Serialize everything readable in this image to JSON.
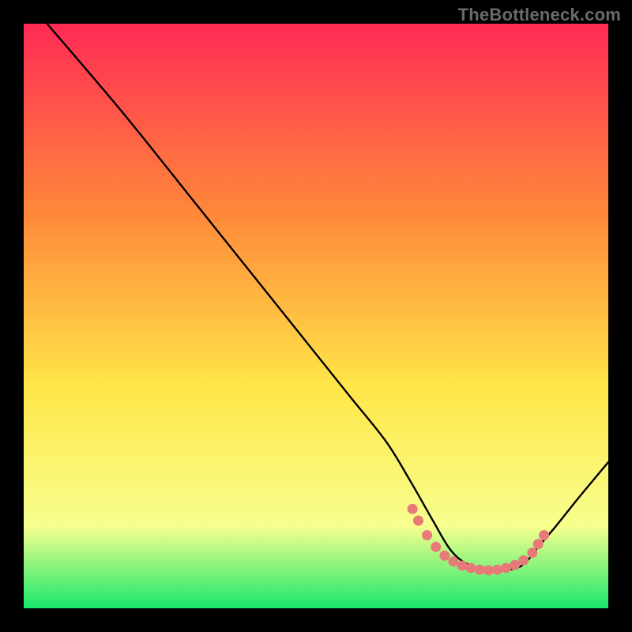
{
  "watermark": "TheBottleneck.com",
  "chart_data": {
    "type": "line",
    "title": "",
    "xlabel": "",
    "ylabel": "",
    "xlim": [
      0,
      100
    ],
    "ylim": [
      0,
      100
    ],
    "grid": false,
    "background_gradient": {
      "top": "#ff2a55",
      "mid1": "#ff8a3a",
      "mid2": "#ffe648",
      "band": "#f7ff8e",
      "bottom": "#17e86b"
    },
    "curve": {
      "name": "bottleneck-curve",
      "description": "Black curve starting at top-left, descending to a flat minimum near x≈73–85, then rising toward the right edge.",
      "x": [
        4,
        10,
        18,
        28,
        38,
        48,
        56,
        62,
        66,
        70,
        73,
        76,
        80,
        84,
        86,
        88,
        91,
        95,
        100
      ],
      "y": [
        100,
        93,
        83.5,
        71,
        58.5,
        46,
        36,
        28.5,
        22,
        15,
        10,
        7.5,
        6.5,
        6.8,
        8,
        10.5,
        14,
        19,
        25
      ]
    },
    "markers": {
      "name": "highlighted-range",
      "color": "#e77a78",
      "points": [
        {
          "x": 66.5,
          "y": 17.0
        },
        {
          "x": 67.5,
          "y": 15.0
        },
        {
          "x": 69.0,
          "y": 12.5
        },
        {
          "x": 70.5,
          "y": 10.5
        },
        {
          "x": 72.0,
          "y": 9.0
        },
        {
          "x": 73.5,
          "y": 8.0
        },
        {
          "x": 75.0,
          "y": 7.3
        },
        {
          "x": 76.5,
          "y": 6.9
        },
        {
          "x": 78.0,
          "y": 6.6
        },
        {
          "x": 79.5,
          "y": 6.5
        },
        {
          "x": 81.0,
          "y": 6.6
        },
        {
          "x": 82.5,
          "y": 6.9
        },
        {
          "x": 84.0,
          "y": 7.4
        },
        {
          "x": 85.5,
          "y": 8.2
        },
        {
          "x": 87.0,
          "y": 9.5
        },
        {
          "x": 88.0,
          "y": 11.0
        },
        {
          "x": 89.0,
          "y": 12.5
        }
      ]
    }
  }
}
